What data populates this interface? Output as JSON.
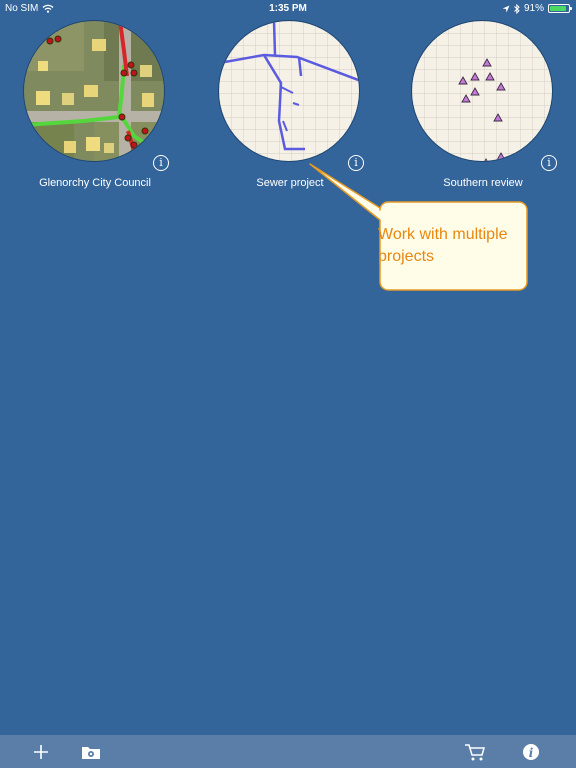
{
  "status_bar": {
    "carrier": "No SIM",
    "time": "1:35 PM",
    "battery_percent": "91%",
    "battery_level": 0.91
  },
  "projects": [
    {
      "name": "Glenorchy City Council",
      "thumbnail": "aerial-imagery-map"
    },
    {
      "name": "Sewer project",
      "thumbnail": "grid-line-map"
    },
    {
      "name": "Southern review",
      "thumbnail": "grid-point-map"
    }
  ],
  "callout": {
    "text": "Work with multiple projects",
    "text_color": "#e8870f"
  },
  "toolbar": {
    "add_icon": "plus-icon",
    "import_icon": "folder-gear-icon",
    "store_icon": "cart-icon",
    "about_icon": "info-icon"
  },
  "colors": {
    "background": "#33659b",
    "toolbar": "#5a7ea7",
    "battery": "#4cd964"
  }
}
